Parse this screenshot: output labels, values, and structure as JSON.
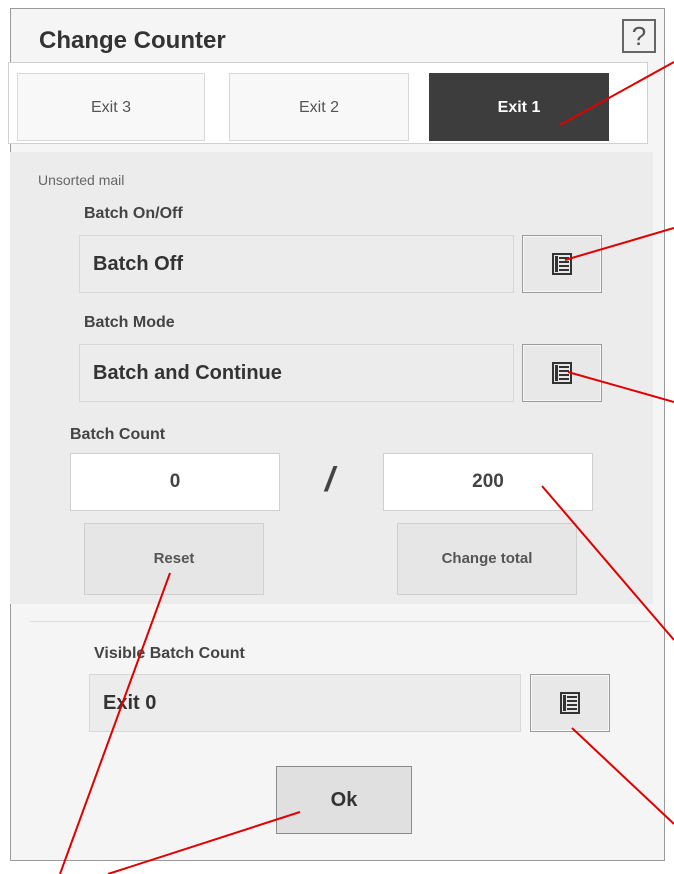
{
  "dialog": {
    "title": "Change Counter",
    "help_label": "?"
  },
  "tabs": [
    {
      "label": "Exit 3",
      "active": false
    },
    {
      "label": "Exit 2",
      "active": false
    },
    {
      "label": "Exit 1",
      "active": true
    }
  ],
  "section": {
    "label": "Unsorted mail"
  },
  "batch_on_off": {
    "label": "Batch On/Off",
    "value": "Batch Off",
    "picker_icon": "list-icon"
  },
  "batch_mode": {
    "label": "Batch Mode",
    "value": "Batch and Continue",
    "picker_icon": "list-icon"
  },
  "batch_count": {
    "label": "Batch Count",
    "current": "0",
    "separator": "/",
    "total": "200",
    "reset_label": "Reset",
    "change_total_label": "Change total"
  },
  "visible_batch_count": {
    "label": "Visible Batch Count",
    "value": "Exit 0",
    "picker_icon": "list-icon"
  },
  "ok_label": "Ok",
  "colors": {
    "active_tab": "#3d3d3d",
    "callout_line": "#e00000",
    "panel": "#ececec"
  }
}
